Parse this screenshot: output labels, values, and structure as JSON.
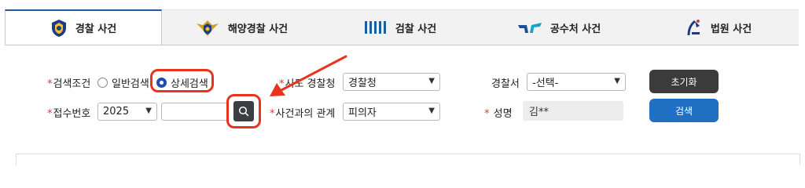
{
  "tabs": [
    {
      "label": "경찰 사건",
      "icon": "police-emblem-icon",
      "active": true
    },
    {
      "label": "해양경찰 사건",
      "icon": "coast-guard-emblem-icon",
      "active": false
    },
    {
      "label": "검찰 사건",
      "icon": "prosecution-emblem-icon",
      "active": false
    },
    {
      "label": "공수처 사건",
      "icon": "cio-emblem-icon",
      "active": false
    },
    {
      "label": "법원 사건",
      "icon": "court-emblem-icon",
      "active": false
    }
  ],
  "form": {
    "search_condition": {
      "label": "검색조건",
      "options": [
        "일반검색",
        "상세검색"
      ],
      "selected": "상세검색"
    },
    "agency": {
      "label": "시도 경찰청",
      "value": "경찰청"
    },
    "station": {
      "label": "경찰서",
      "value": "-선택-"
    },
    "receipt_no": {
      "label": "접수번호",
      "year": "2025",
      "number": ""
    },
    "relation": {
      "label": "사건과의 관계",
      "value": "피의자"
    },
    "name": {
      "label": "성명",
      "value": "김**"
    }
  },
  "buttons": {
    "reset": "초기화",
    "search": "검색"
  },
  "colors": {
    "accent": "#1f6fc2",
    "required": "#d63a3a",
    "annotation": "#e8331f"
  }
}
